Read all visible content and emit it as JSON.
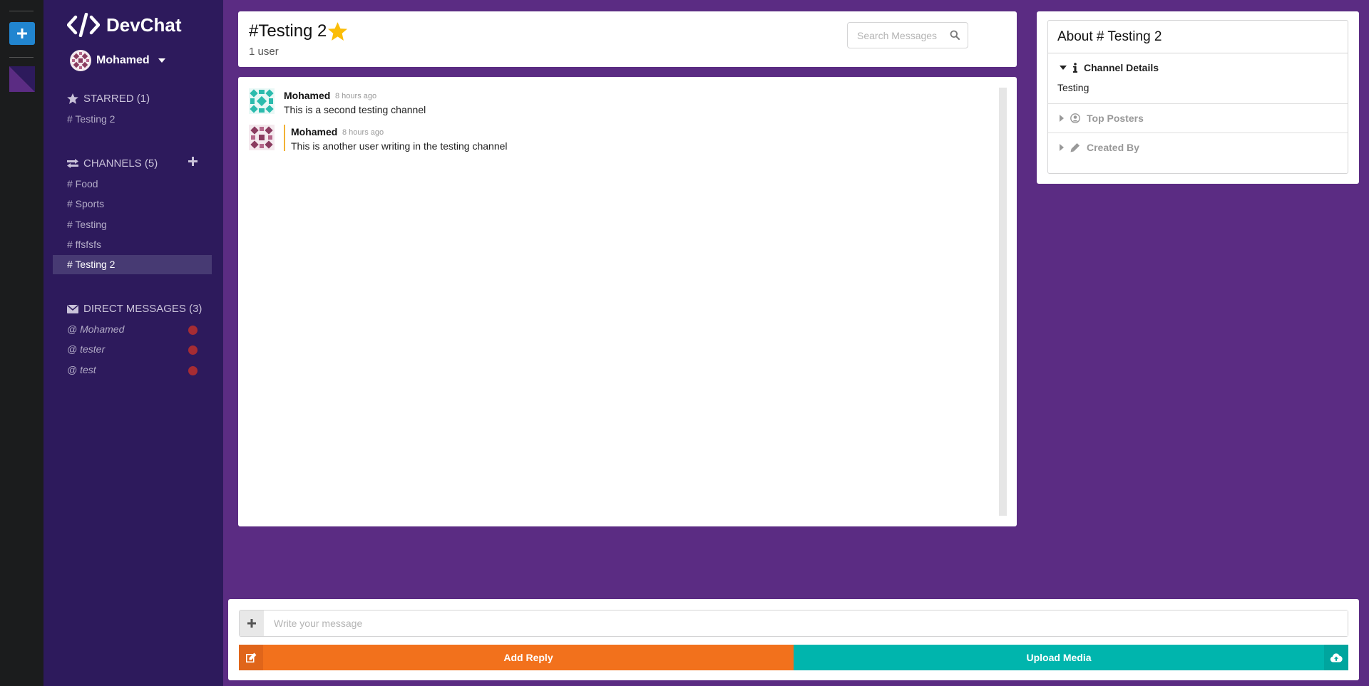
{
  "colors": {
    "rail": "#1b1c1d",
    "sidebar": "#2d1a5c",
    "background": "#5b2c83",
    "primary": "#2185d0",
    "reply": "#f2711c",
    "upload": "#00b5ad",
    "star": "#fbbd08",
    "notification": "#a62c33"
  },
  "rail": {
    "add_icon": "plus-icon"
  },
  "brand": {
    "name": "DevChat",
    "icon": "code-icon"
  },
  "user": {
    "name": "Mohamed",
    "avatar": "identicon-avatar",
    "caret_icon": "caret-down-icon"
  },
  "starred": {
    "label": "STARRED (1)",
    "icon": "star-icon",
    "items": [
      "# Testing 2"
    ]
  },
  "channels": {
    "label": "CHANNELS (5)",
    "icon": "exchange-icon",
    "add_icon": "plus-icon",
    "items": [
      "# Food",
      "# Sports",
      "# Testing",
      "# ffsfsfs",
      "# Testing 2"
    ],
    "active_index": 4
  },
  "direct_messages": {
    "label": "DIRECT MESSAGES (3)",
    "icon": "envelope-icon",
    "items": [
      "@ Mohamed",
      "@ tester",
      "@ test"
    ]
  },
  "header": {
    "title": "#Testing 2",
    "star_icon": "star-icon",
    "users": "1 user",
    "search_placeholder": "Search Messages",
    "search_icon": "search-icon"
  },
  "messages": [
    {
      "author": "Mohamed",
      "time": "8 hours ago",
      "text": "This is a second testing channel",
      "own": false
    },
    {
      "author": "Mohamed",
      "time": "8 hours ago",
      "text": "This is another user writing in the testing channel",
      "own": true
    }
  ],
  "about": {
    "title": "About # Testing 2",
    "sections": [
      {
        "label": "Channel Details",
        "icon": "info-icon",
        "expanded": true,
        "content": "Testing"
      },
      {
        "label": "Top Posters",
        "icon": "user-circle-icon",
        "expanded": false
      },
      {
        "label": "Created By",
        "icon": "pencil-icon",
        "expanded": false
      }
    ]
  },
  "composer": {
    "placeholder": "Write your message",
    "attach_icon": "plus-icon",
    "reply_label": "Add Reply",
    "reply_icon": "edit-icon",
    "upload_label": "Upload Media",
    "upload_icon": "cloud-upload-icon"
  }
}
